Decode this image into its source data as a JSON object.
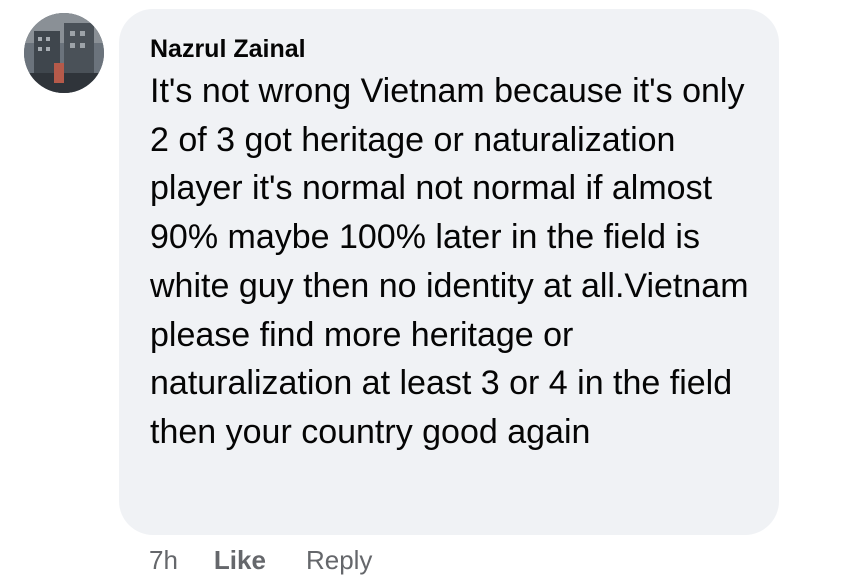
{
  "comment": {
    "author": "Nazrul Zainal",
    "text": "It's not wrong Vietnam because it's only 2 of 3 got heritage or naturalization player it's normal not normal if almost 90% maybe 100% later in the field is white guy then no identity at all.Vietnam please find more heritage or naturalization at least 3 or 4 in the field then your country good again",
    "avatar_icon": "profile-photo"
  },
  "actions": {
    "time": "7h",
    "like_label": "Like",
    "reply_label": "Reply"
  },
  "colors": {
    "bubble": "#f0f2f5",
    "text": "#050505",
    "secondary_text": "#65676b"
  }
}
